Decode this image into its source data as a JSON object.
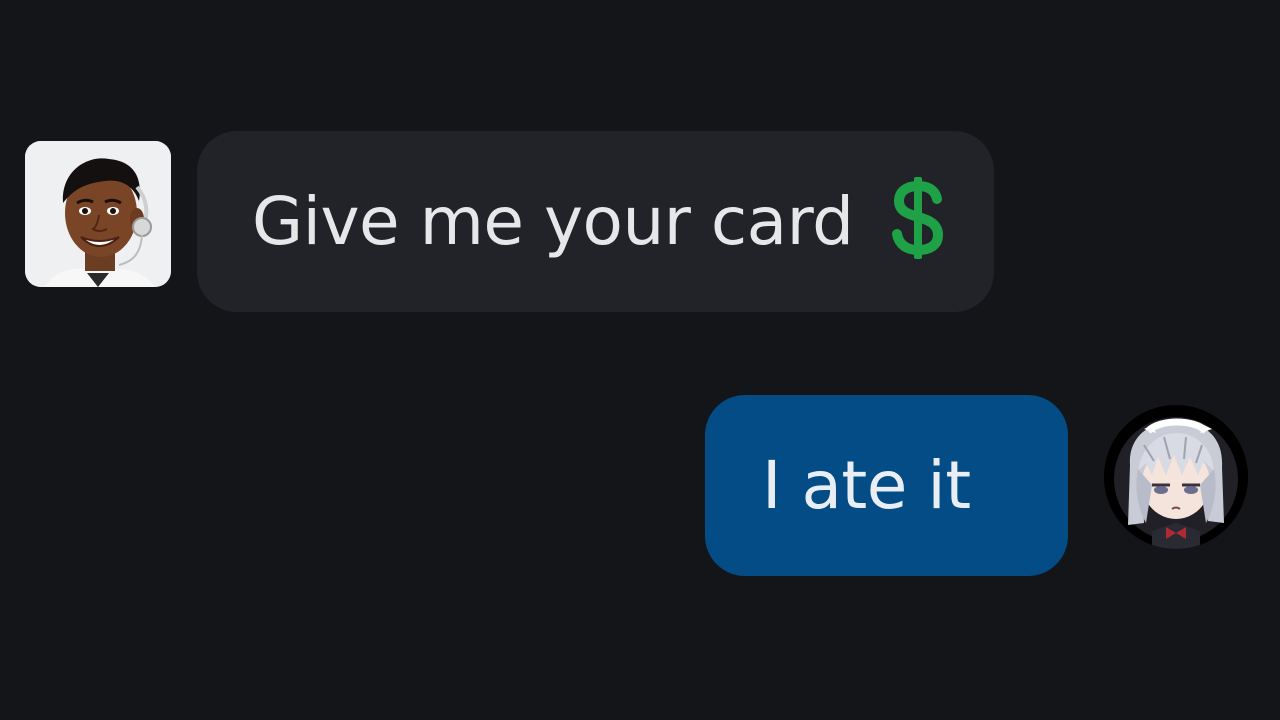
{
  "messages": [
    {
      "direction": "incoming",
      "text": "Give me your card",
      "emoji": "dollar-sign",
      "bubble_color": "#212329",
      "avatar": "support-agent-headset-photo"
    },
    {
      "direction": "outgoing",
      "text": "I ate it",
      "bubble_color": "#034c85",
      "avatar": "anime-maid-girl-portrait"
    }
  ],
  "colors": {
    "background": "#141518",
    "incoming_text": "#e7e7ea",
    "outgoing_text": "#e9eef4",
    "emoji_green": "#1fa247"
  }
}
